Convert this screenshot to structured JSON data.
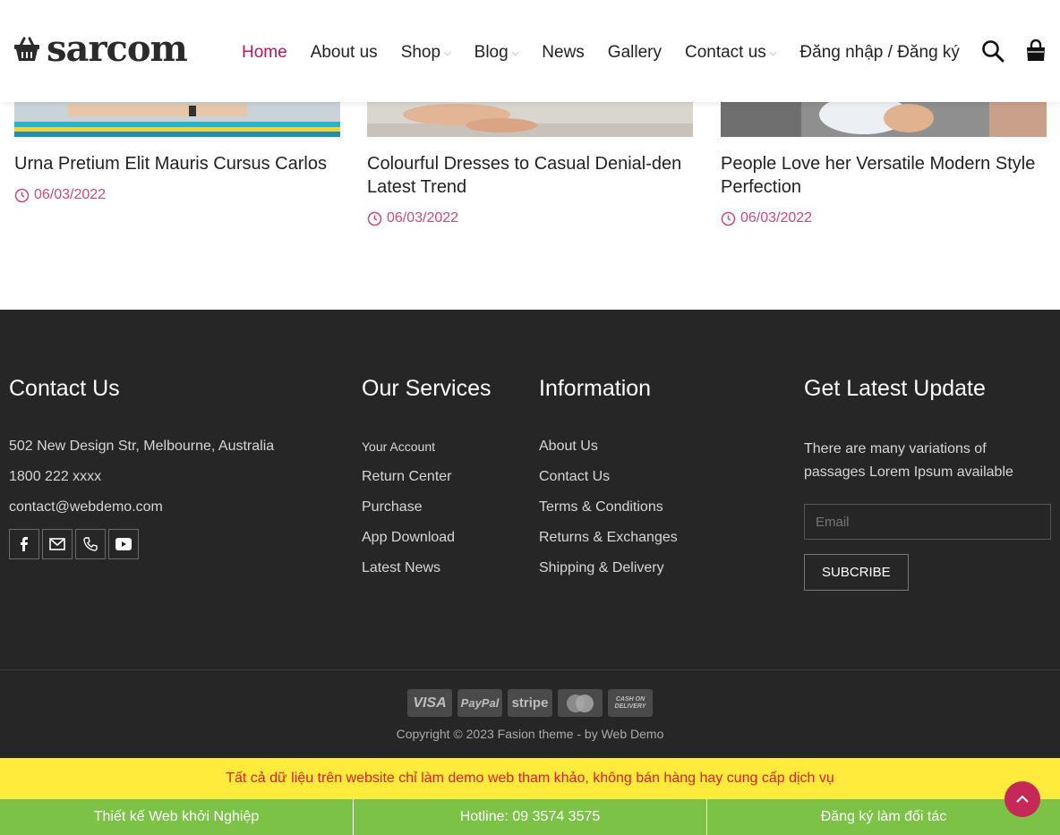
{
  "header": {
    "logo_text": "sarcom",
    "nav": [
      {
        "label": "Home",
        "active": true,
        "dropdown": false
      },
      {
        "label": "About us",
        "active": false,
        "dropdown": false
      },
      {
        "label": "Shop",
        "active": false,
        "dropdown": true
      },
      {
        "label": "Blog",
        "active": false,
        "dropdown": true
      },
      {
        "label": "News",
        "active": false,
        "dropdown": false
      },
      {
        "label": "Gallery",
        "active": false,
        "dropdown": false
      },
      {
        "label": "Contact us",
        "active": false,
        "dropdown": true
      },
      {
        "label": "Đăng nhập / Đăng ký",
        "active": false,
        "dropdown": false
      }
    ],
    "icons": [
      "search-icon",
      "shopping-bag-icon"
    ],
    "accent_color": "#b5175d"
  },
  "posts": [
    {
      "title": "Urna Pretium Elit Mauris Cursus Carlos",
      "date": "06/03/2022"
    },
    {
      "title": "Colourful Dresses to Casual Denial-den Latest Trend",
      "date": "06/03/2022"
    },
    {
      "title": "People Love her Versatile Modern Style Perfection",
      "date": "06/03/2022"
    }
  ],
  "footer": {
    "contact": {
      "heading": "Contact Us",
      "address": "502 New Design Str, Melbourne, Australia",
      "phone": "1800 222 xxxx",
      "email": "contact@webdemo.com",
      "socials": [
        "facebook-icon",
        "envelope-icon",
        "phone-icon",
        "youtube-icon"
      ]
    },
    "services": {
      "heading": "Our Services",
      "items": [
        "Your Account",
        "Return Center",
        "Purchase",
        "App Download",
        "Latest News"
      ]
    },
    "information": {
      "heading": "Information",
      "items": [
        "About Us",
        "Contact Us",
        "Terms & Conditions",
        "Returns & Exchanges",
        "Shipping & Delivery"
      ]
    },
    "newsletter": {
      "heading": "Get Latest Update",
      "text": "There are many variations of passages Lorem Ipsum available",
      "email_placeholder": "Email",
      "button": "SUBCRIBE"
    }
  },
  "bottom": {
    "payments": [
      "VISA",
      "PayPal",
      "stripe",
      "MasterCard",
      "CASH ON DELIVERY"
    ],
    "copyright": "Copyright © 2023 Fasion theme - by Web Demo"
  },
  "notice": "Tất cả dữ liệu trên website chỉ làm demo web tham khảo, không bán hàng hay cung cấp dịch vụ",
  "cta_bar": [
    "Thiết kế Web khởi Nghiệp",
    "Hotline: 09 3574 3575",
    "Đăng ký làm đối tác"
  ]
}
